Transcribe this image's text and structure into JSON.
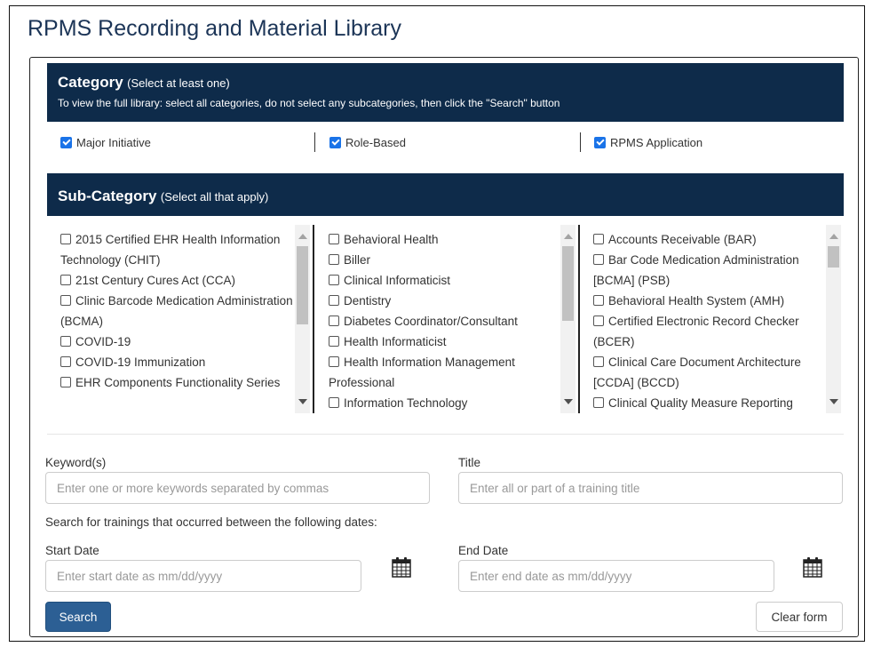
{
  "page": {
    "title": "RPMS Recording and Material Library"
  },
  "category": {
    "title": "Category",
    "note": "(Select at least one)",
    "description": "To view the full library: select all categories, do not select any subcategories, then click the \"Search\" button",
    "items": [
      {
        "label": "Major Initiative",
        "checked": true
      },
      {
        "label": "Role-Based",
        "checked": true
      },
      {
        "label": "RPMS Application",
        "checked": true
      }
    ]
  },
  "subcategory": {
    "title": "Sub-Category",
    "note": "(Select all that apply)",
    "columns": [
      {
        "items": [
          {
            "label": "2015 Certified EHR Health Information Technology (CHIT)",
            "checked": false
          },
          {
            "label": "21st Century Cures Act (CCA)",
            "checked": false
          },
          {
            "label": "Clinic Barcode Medication Administration (BCMA)",
            "checked": false
          },
          {
            "label": "COVID-19",
            "checked": false
          },
          {
            "label": "COVID-19 Immunization",
            "checked": false
          },
          {
            "label": "EHR Components Functionality Series",
            "checked": false
          }
        ]
      },
      {
        "items": [
          {
            "label": "Behavioral Health",
            "checked": false
          },
          {
            "label": "Biller",
            "checked": false
          },
          {
            "label": "Clinical Informaticist",
            "checked": false
          },
          {
            "label": "Dentistry",
            "checked": false
          },
          {
            "label": "Diabetes Coordinator/Consultant",
            "checked": false
          },
          {
            "label": "Health Informaticist",
            "checked": false
          },
          {
            "label": "Health Information Management Professional",
            "checked": false
          },
          {
            "label": "Information Technology",
            "checked": false
          }
        ]
      },
      {
        "items": [
          {
            "label": "Accounts Receivable (BAR)",
            "checked": false
          },
          {
            "label": "Bar Code Medication Administration [BCMA] (PSB)",
            "checked": false
          },
          {
            "label": "Behavioral Health System (AMH)",
            "checked": false
          },
          {
            "label": "Certified Electronic Record Checker (BCER)",
            "checked": false
          },
          {
            "label": "Clinical Care Document Architecture [CCDA] (BCCD)",
            "checked": false
          },
          {
            "label": "Clinical Quality Measure Reporting",
            "checked": false
          }
        ]
      }
    ]
  },
  "search": {
    "keyword_label": "Keyword(s)",
    "keyword_placeholder": "Enter one or more keywords separated by commas",
    "title_label": "Title",
    "title_placeholder": "Enter all or part of a training title",
    "date_note": "Search for trainings that occurred between the following dates:",
    "start_label": "Start Date",
    "start_placeholder": "Enter start date as mm/dd/yyyy",
    "end_label": "End Date",
    "end_placeholder": "Enter end date as mm/dd/yyyy",
    "search_button": "Search",
    "clear_button": "Clear form"
  },
  "icons": {
    "calendar": "calendar-icon"
  },
  "colors": {
    "band": "#0e2b4a",
    "primary_button": "#2c5f94",
    "checkbox": "#1a73e8"
  }
}
